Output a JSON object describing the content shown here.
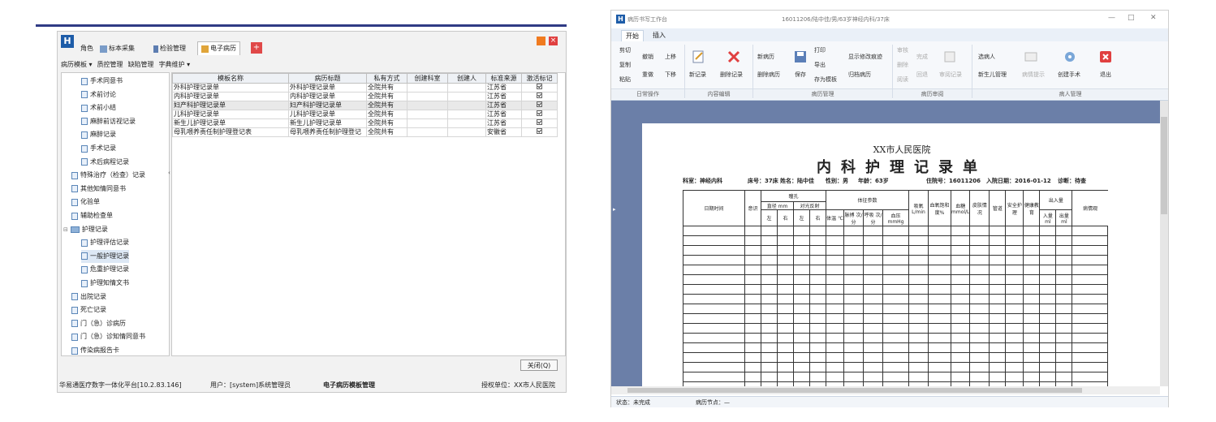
{
  "left_window": {
    "tabs": [
      {
        "label": "角色",
        "icon": "role-icon"
      },
      {
        "label": "标本采集",
        "icon": "sample-icon"
      },
      {
        "label": "检验管理",
        "icon": "lab-icon"
      },
      {
        "label": "电子病历",
        "icon": "emr-icon"
      }
    ],
    "add_tab_glyph": "+",
    "close_glyph": "×",
    "menu": [
      "病历模板 ▾",
      "质控管理",
      "缺陷管理",
      "字典维护 ▾"
    ],
    "tree": [
      {
        "label": "手术同意书",
        "level": 2
      },
      {
        "label": "术前讨论",
        "level": 2
      },
      {
        "label": "术前小结",
        "level": 2
      },
      {
        "label": "麻醉前访视记录",
        "level": 2
      },
      {
        "label": "麻醉记录",
        "level": 2
      },
      {
        "label": "手术记录",
        "level": 2
      },
      {
        "label": "术后病程记录",
        "level": 2
      },
      {
        "label": "特殊治疗（检查）记录",
        "level": 1
      },
      {
        "label": "其他知情同意书",
        "level": 1
      },
      {
        "label": "化验单",
        "level": 1
      },
      {
        "label": "辅助检查单",
        "level": 1
      },
      {
        "label": "护理记录",
        "level": 0,
        "folder": true,
        "toggle": "⊟"
      },
      {
        "label": "护理评估记录",
        "level": 2
      },
      {
        "label": "一般护理记录",
        "level": 2,
        "selected": true
      },
      {
        "label": "危重护理记录",
        "level": 2
      },
      {
        "label": "护理知情文书",
        "level": 2
      },
      {
        "label": "出院记录",
        "level": 1
      },
      {
        "label": "死亡记录",
        "level": 1
      },
      {
        "label": "门（急）诊病历",
        "level": 1
      },
      {
        "label": "门（急）诊知情同意书",
        "level": 1
      },
      {
        "label": "传染病报告卡",
        "level": 1
      }
    ],
    "splitter_glyph": "‹",
    "table": {
      "columns": [
        "模板名称",
        "病历标题",
        "私有方式",
        "创建科室",
        "创建人",
        "标准来源",
        "激活标记"
      ],
      "rows": [
        [
          "外科护理记录单",
          "外科护理记录单",
          "全院共有",
          "",
          "",
          "江苏省",
          true
        ],
        [
          "内科护理记录单",
          "内科护理记录单",
          "全院共有",
          "",
          "",
          "江苏省",
          true
        ],
        [
          "妇产科护理记录单",
          "妇产科护理记录单",
          "全院共有",
          "",
          "",
          "江苏省",
          true
        ],
        [
          "儿科护理记录单",
          "儿科护理记录单",
          "全院共有",
          "",
          "",
          "江苏省",
          true
        ],
        [
          "新生儿护理记录单",
          "新生儿护理记录单",
          "全院共有",
          "",
          "",
          "江苏省",
          true
        ],
        [
          "母乳喂养责任制护理登记表",
          "母乳喂养责任制护理登记",
          "全院共有",
          "",
          "",
          "安徽省",
          true
        ]
      ]
    },
    "close_button": "关闭(Q)",
    "status": {
      "platform": "华易通医疗数字一体化平台[10.2.83.146]",
      "user": "用户：[system]系统管理员",
      "module": "电子病历模板管理",
      "unit": "授权单位：XX市人民医院"
    }
  },
  "right_window": {
    "title": "病历书写工作台",
    "title_center": "16011206/陆中佳/男/63岁神经内科/37床",
    "window_controls": [
      "—",
      "□",
      "✕"
    ],
    "tabs": [
      "开始",
      "插入"
    ],
    "ribbon": {
      "clipboard": [
        "剪切",
        "复制",
        "粘贴"
      ],
      "undo": [
        "撤销",
        "重做"
      ],
      "move": [
        "上移",
        "下移"
      ],
      "new_record": "新记录",
      "delete_record": "删除记录",
      "new_case": "新病历",
      "delete_case": "删除病历",
      "save": "保存",
      "print": "打印",
      "export": "导出",
      "save_template": "存为模板",
      "show_trace": "显示修改痕迹",
      "archive": "归档病历",
      "review": [
        "审核",
        "删除",
        "阅读"
      ],
      "complete": "完成",
      "go_back": "回退",
      "audit_record": "审阅记录",
      "select_patient": "选病人",
      "newborn_manage": "新生儿管理",
      "disease_hint": "病情提示",
      "create_surgery": "创建手术",
      "exit": "退出",
      "groups": [
        "日常操作",
        "内容编辑",
        "病历管理",
        "病历审阅",
        "病人管理"
      ]
    },
    "doc": {
      "hospital": "XX市人民医院",
      "title": "内科护理记录单",
      "info": [
        "科室：神经内科",
        "床号：37床",
        "姓名：陆中佳",
        "性别：男",
        "年龄：63岁",
        "住院号：16011206",
        "入院日期：2016-01-12",
        "诊断：待查"
      ],
      "headers": {
        "datetime": "日期时间",
        "consciousness": "意识",
        "pupil": "瞳孔",
        "diameter": "直径 mm",
        "light_reflex": "对光反射",
        "left": "左",
        "right": "右",
        "vitals": "体征参数",
        "temp": "体温 ℃",
        "pulse": "脉搏 次/分",
        "resp": "呼吸 次/分",
        "bp": "血压 mmHg",
        "oxygen": "吸氧 L/min",
        "spo2": "血氧饱和度%",
        "glucose": "血糖 mmol/L",
        "skin": "皮肤情况",
        "tube": "管道",
        "safety": "安全护理",
        "edu": "健康教育",
        "io": "出入量",
        "intake": "入量 ml",
        "output": "出量 ml",
        "observe": "病情观"
      }
    },
    "status": {
      "state": "状态：未完成",
      "node": "病历节点：—"
    }
  }
}
